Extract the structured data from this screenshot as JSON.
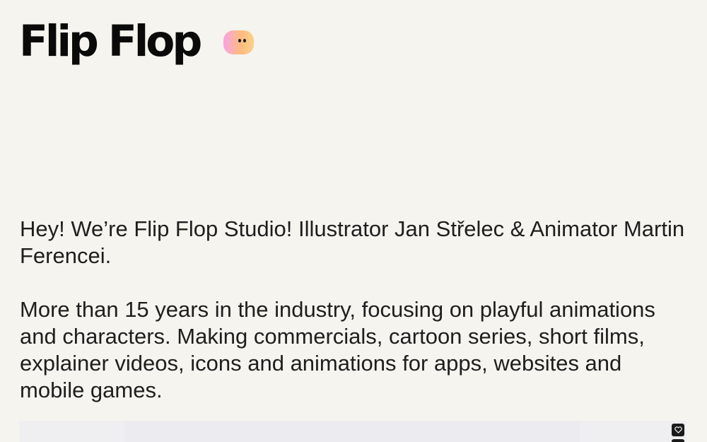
{
  "brand": {
    "logo_text": "Flip Flop",
    "mascot_icon": "blob-face-icon",
    "mascot_gradient": [
      "#f7a3e6",
      "#fdbb7f",
      "#fbd08a"
    ]
  },
  "intro": {
    "paragraph_1": "Hey! We’re Flip Flop Studio! Illustrator Jan Střelec & Animator Martin Ferencei.",
    "paragraph_2": "More than 15 years in the industry, focusing on playful animations and characters. Making commercials, cartoon series, short films, explainer videos, icons and animations for apps, websites and mobile games."
  },
  "media": {
    "like_icon": "heart-icon"
  },
  "colors": {
    "background": "#f5f4ee",
    "text": "#1e1e1e",
    "logo": "#0a0a0a",
    "button": "#1b1b1b"
  }
}
